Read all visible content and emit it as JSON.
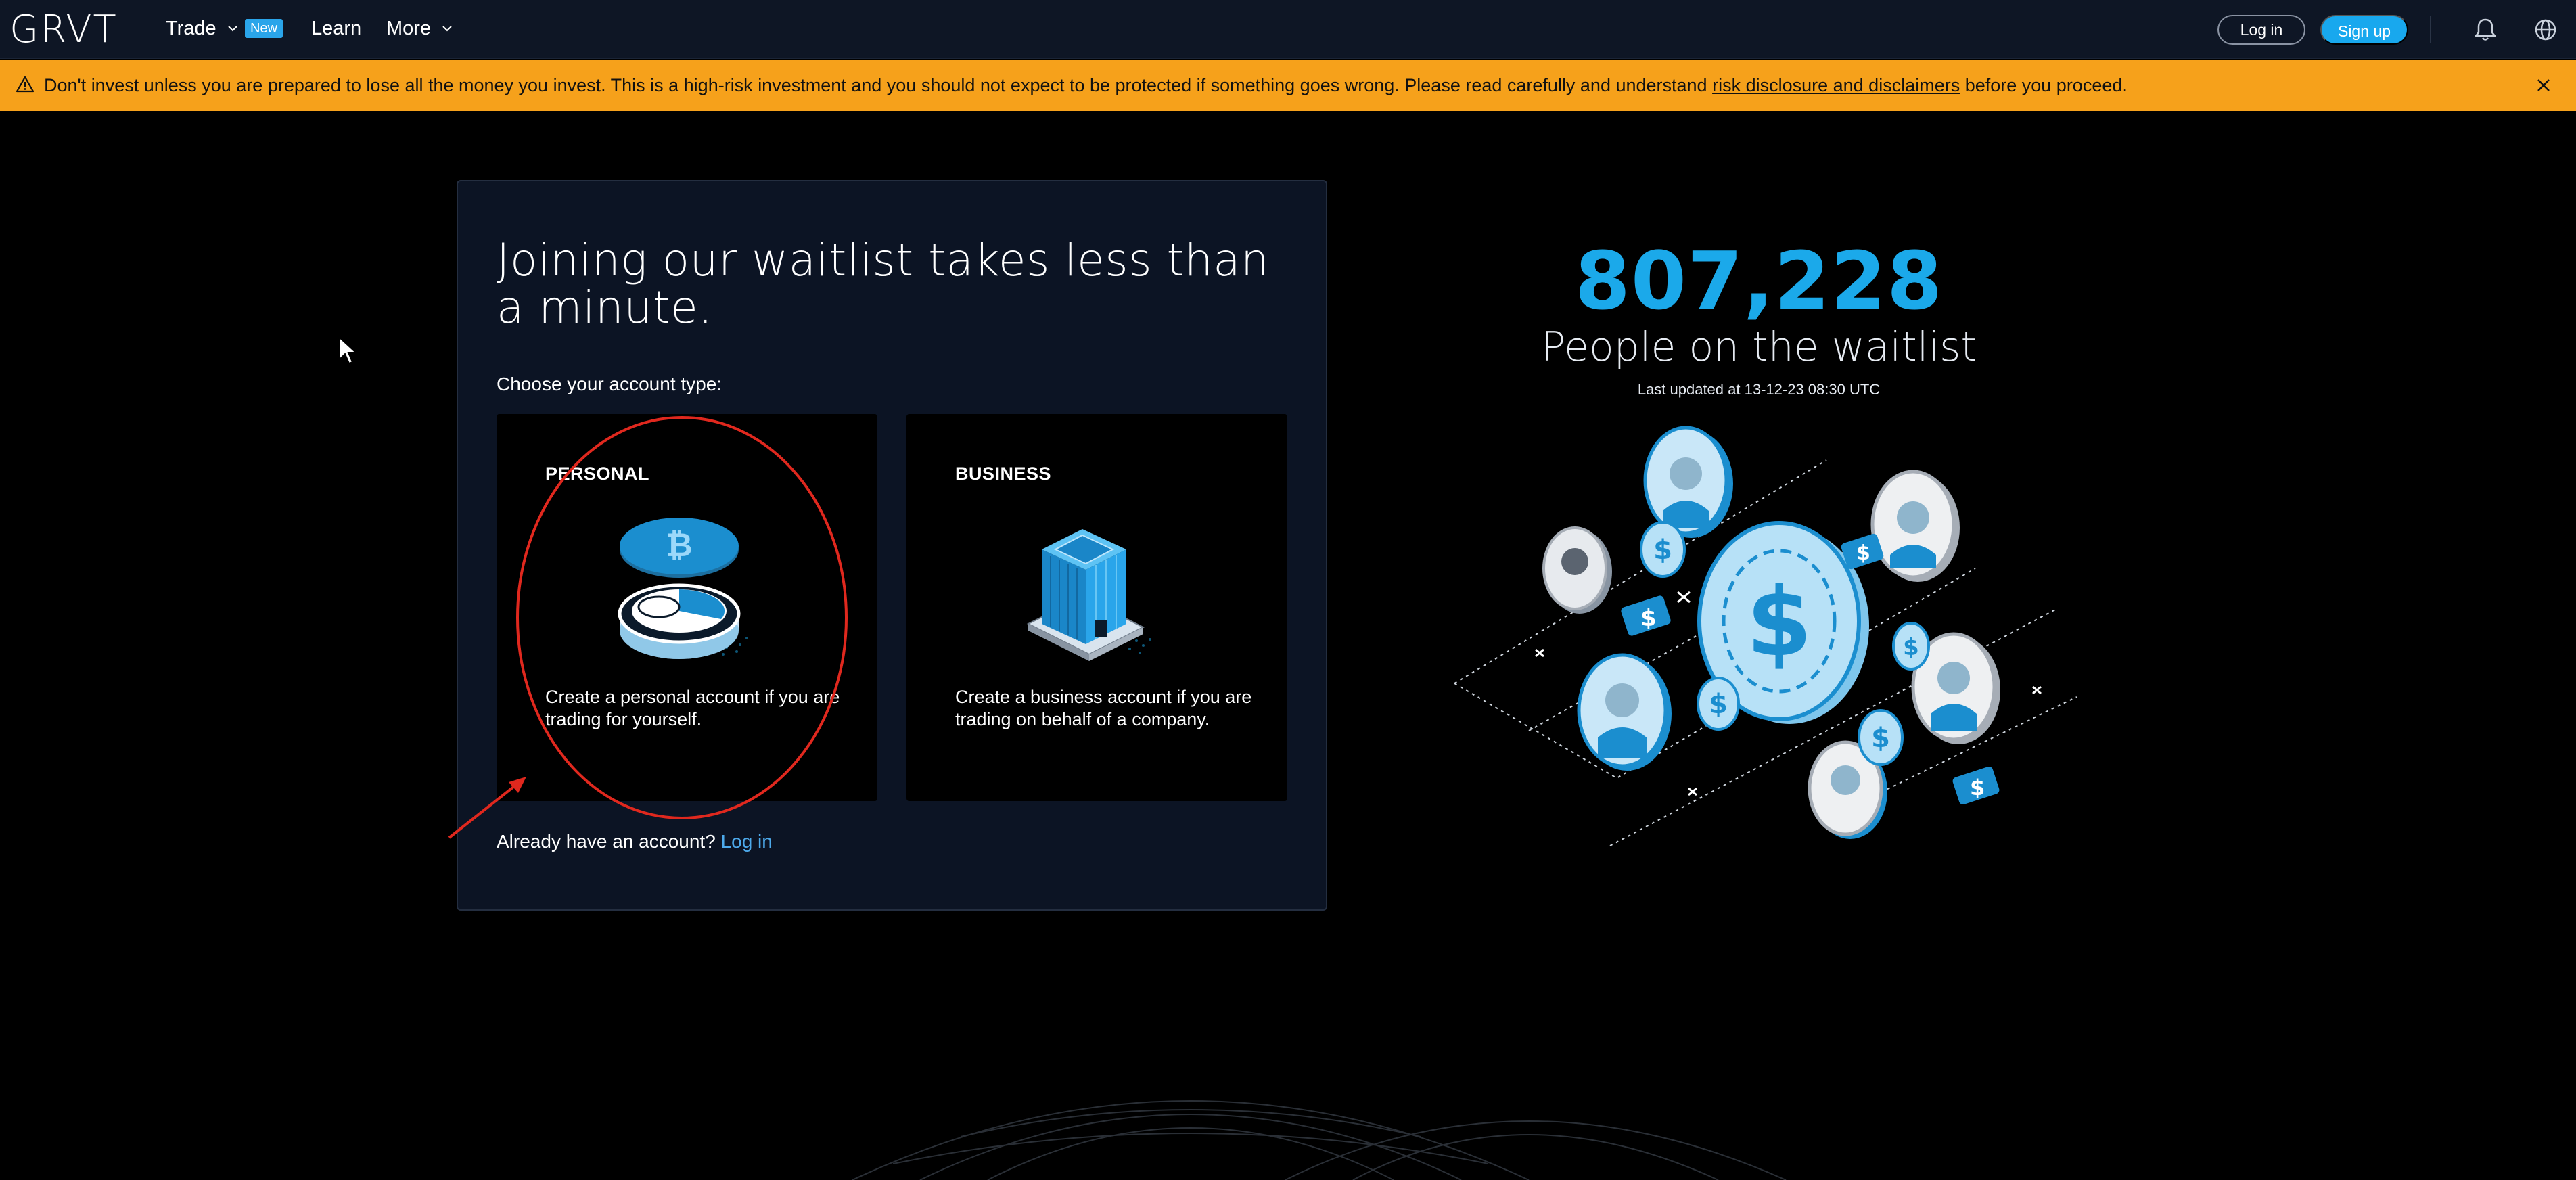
{
  "nav": {
    "logo": "GRVT",
    "trade_label": "Trade",
    "new_badge": "New",
    "learn_label": "Learn",
    "more_label": "More",
    "login_label": "Log in",
    "signup_label": "Sign up",
    "icons": {
      "bell": "bell-icon",
      "globe": "globe-icon",
      "chevron": "chevron-down-icon"
    }
  },
  "banner": {
    "text_before": "Don't invest unless you are prepared to lose all the money you invest. This is a high-risk investment and you should not expect to be protected if something goes wrong. Please read carefully and understand ",
    "link_text": "risk disclosure and disclaimers",
    "text_after": " before you proceed.",
    "color": "#f6a11b",
    "icons": {
      "warning": "warning-icon",
      "close": "close-icon"
    }
  },
  "waitlist_card": {
    "title": "Joining our waitlist takes less than a minute.",
    "choose_label": "Choose your account type:",
    "accounts": [
      {
        "title": "PERSONAL",
        "description": "Create a personal account if you are trading for yourself."
      },
      {
        "title": "BUSINESS",
        "description": "Create a business account if you are trading on behalf of a company."
      }
    ],
    "already_text": "Already have an account?",
    "login_link": "Log in"
  },
  "stats": {
    "count": "807,228",
    "label": "People on the waitlist",
    "updated": "Last updated at 13-12-23 08:30 UTC",
    "accent_color": "#1ba9ea"
  }
}
